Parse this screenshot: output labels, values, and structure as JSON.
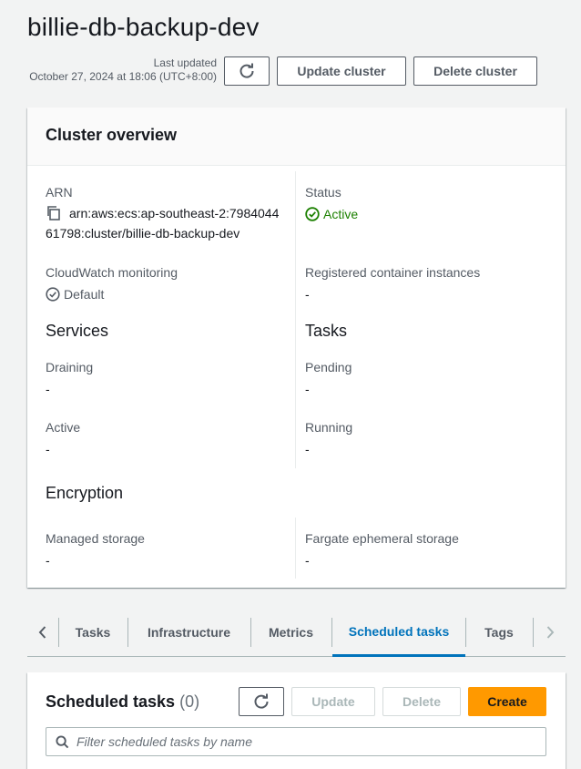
{
  "page": {
    "title": "billie-db-backup-dev",
    "last_updated_label": "Last updated",
    "last_updated_value": "October 27, 2024 at 18:06 (UTC+8:00)"
  },
  "actions": {
    "refresh_icon": "refresh-icon",
    "update_label": "Update cluster",
    "delete_label": "Delete cluster"
  },
  "overview": {
    "title": "Cluster overview",
    "arn_label": "ARN",
    "arn_line1": "arn:aws:ecs:ap-southeast-2:7984044",
    "arn_line2": "61798:cluster/billie-db-backup-dev",
    "status_label": "Status",
    "status_value": "Active",
    "cloudwatch_label": "CloudWatch monitoring",
    "cloudwatch_value": "Default",
    "instances_label": "Registered container instances",
    "instances_value": "-",
    "services_heading": "Services",
    "tasks_heading": "Tasks",
    "draining_label": "Draining",
    "draining_value": "-",
    "pending_label": "Pending",
    "pending_value": "-",
    "services_active_label": "Active",
    "services_active_value": "-",
    "running_label": "Running",
    "running_value": "-",
    "encryption_heading": "Encryption",
    "managed_storage_label": "Managed storage",
    "managed_storage_value": "-",
    "fargate_label": "Fargate ephemeral storage",
    "fargate_value": "-"
  },
  "colors": {
    "status_active": "#1d8102",
    "tab_active": "#0073bb",
    "primary_button": "#ff9900"
  },
  "tabs": [
    {
      "label": "Tasks"
    },
    {
      "label": "Infrastructure"
    },
    {
      "label": "Metrics"
    },
    {
      "label": "Scheduled tasks",
      "active": true
    },
    {
      "label": "Tags"
    }
  ],
  "scheduled": {
    "title": "Scheduled tasks",
    "count": "(0)",
    "update_label": "Update",
    "delete_label": "Delete",
    "create_label": "Create",
    "search_placeholder": "Filter scheduled tasks by name"
  }
}
